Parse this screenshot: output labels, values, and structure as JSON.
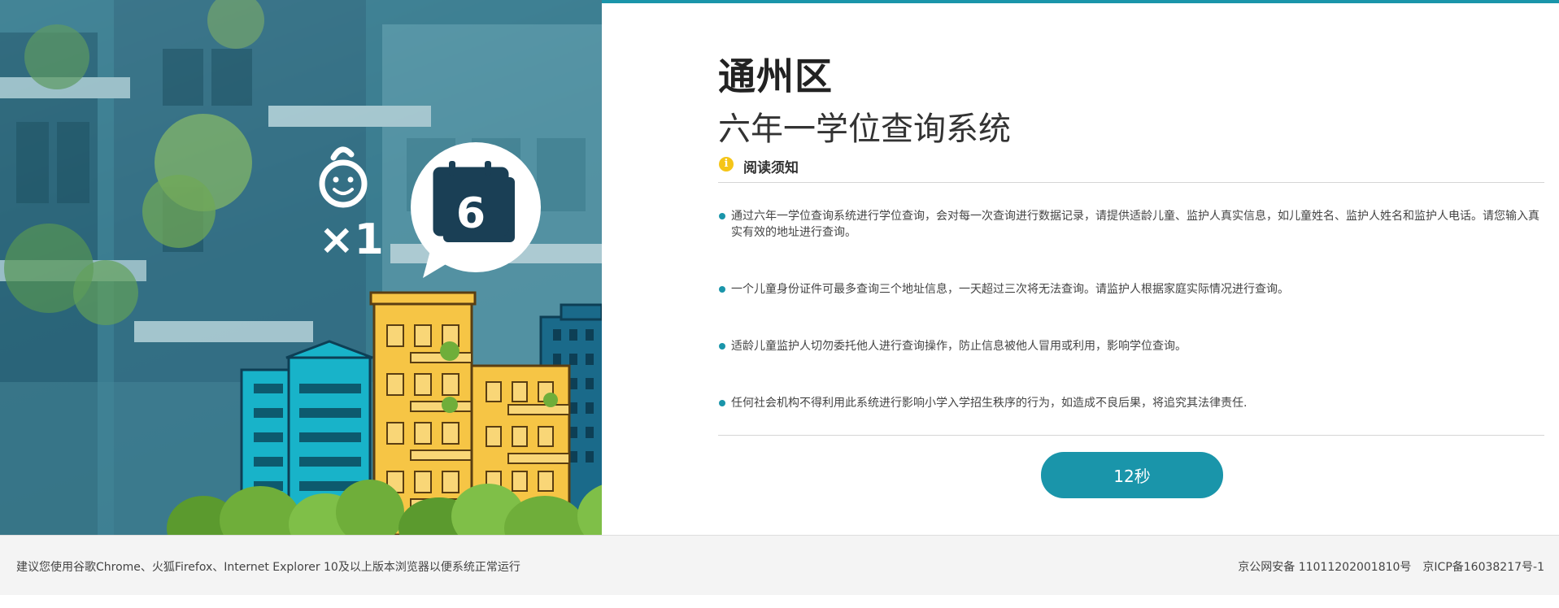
{
  "header": {
    "title": "通州区",
    "subtitle": "六年一学位查询系统"
  },
  "notice": {
    "icon": "info-icon",
    "icon_glyph": "i",
    "title": "阅读须知",
    "items": [
      "通过六年一学位查询系统进行学位查询，会对每一次查询进行数据记录，请提供适龄儿童、监护人真实信息，如儿童姓名、监护人姓名和监护人电话。请您输入真实有效的地址进行查询。",
      "一个儿童身份证件可最多查询三个地址信息，一天超过三次将无法查询。请监护人根据家庭实际情况进行查询。",
      "适龄儿童监护人切勿委托他人进行查询操作，防止信息被他人冒用或利用，影响学位查询。",
      "任何社会机构不得利用此系统进行影响小学入学招生秩序的行为，如造成不良后果，将追究其法律责任."
    ]
  },
  "countdown_button": {
    "label": "12秒"
  },
  "hero": {
    "times_label": "×1",
    "calendar_number": "6"
  },
  "footer": {
    "browser_tip": "建议您使用谷歌Chrome、火狐Firefox、Internet Explorer 10及以上版本浏览器以便系统正常运行",
    "police_record": "京公网安备 11011202001810号",
    "icp_record": "京ICP备16038217号-1"
  },
  "colors": {
    "accent": "#1a95aa",
    "info_icon": "#f5c518",
    "building_yellow": "#f6c545",
    "building_cyan": "#18b3c9",
    "tree_green": "#6fae3a"
  }
}
